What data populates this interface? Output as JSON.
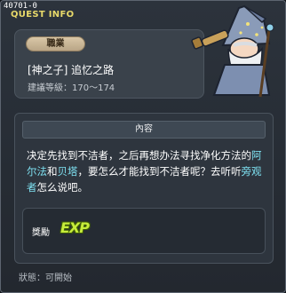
{
  "window": {
    "quest_id": "40701-0",
    "title": "QUEST INFO"
  },
  "job": {
    "badge": "職業",
    "quest_name": "[神之子] 追忆之路",
    "recommended_level": "建議等級：170～174"
  },
  "content": {
    "header": "內容",
    "text_1": "决定先找到不洁者，之后再想办法寻找净化方法的",
    "name_1": "阿尔法",
    "and_text": "和",
    "name_2": "贝塔",
    "text_2": "，要怎么才能找到不洁者呢？去听听",
    "name_3": "旁观者",
    "text_3": "怎么说吧。"
  },
  "reward": {
    "label": "獎勵",
    "exp_icon_text": "EXP"
  },
  "status": {
    "text": "狀態：可開始"
  },
  "colors": {
    "highlight": "#7ee0f0",
    "title": "#e8d96a",
    "exp": "#c6ec3a"
  },
  "icons": {
    "npc": "wizard-npc-portrait",
    "exp": "exp-icon"
  }
}
